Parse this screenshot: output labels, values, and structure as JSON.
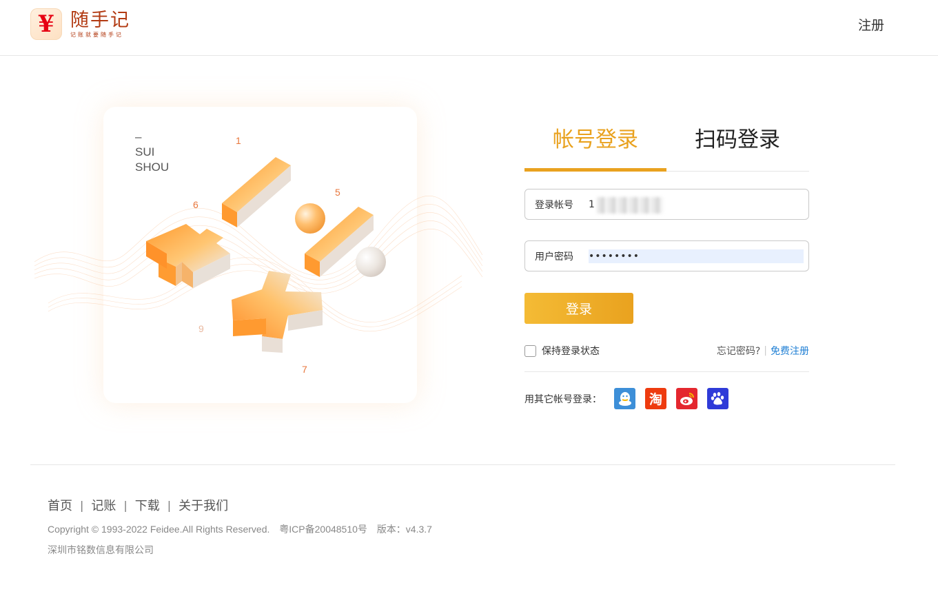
{
  "header": {
    "logo_symbol": "¥",
    "logo_name": "随手记",
    "logo_slogan": "记账就要随手记",
    "register_label": "注册"
  },
  "hero": {
    "brand_dash": "–",
    "brand_line1": "SUI",
    "brand_line2": "SHOU",
    "numbers": [
      "1",
      "5",
      "6",
      "9",
      "7"
    ]
  },
  "login": {
    "tab_account": "帐号登录",
    "tab_qrcode": "扫码登录",
    "account_label": "登录帐号",
    "account_value": "1",
    "password_label": "用户密码",
    "password_value": "••••••••",
    "submit_label": "登录",
    "remember_label": "保持登录状态",
    "forgot_label": "忘记密码?",
    "separator": "|",
    "free_register_label": "免费注册",
    "social_label": "用其它帐号登录：",
    "social_icons": [
      "qq-icon",
      "taobao-icon",
      "weibo-icon",
      "baidu-icon"
    ],
    "taobao_glyph": "淘"
  },
  "footer": {
    "nav": [
      "首页",
      "记账",
      "下载",
      "关于我们"
    ],
    "nav_separator": "|",
    "copyright": "Copyright © 1993-2022 Feidee.All Rights Reserved.",
    "icp": "粤ICP备20048510号",
    "version": "版本：v4.3.7",
    "company": "深圳市铭数信息有限公司"
  },
  "colors": {
    "accent": "#e9a21f",
    "link": "#1f7fd4",
    "logo_red": "#e60012"
  }
}
